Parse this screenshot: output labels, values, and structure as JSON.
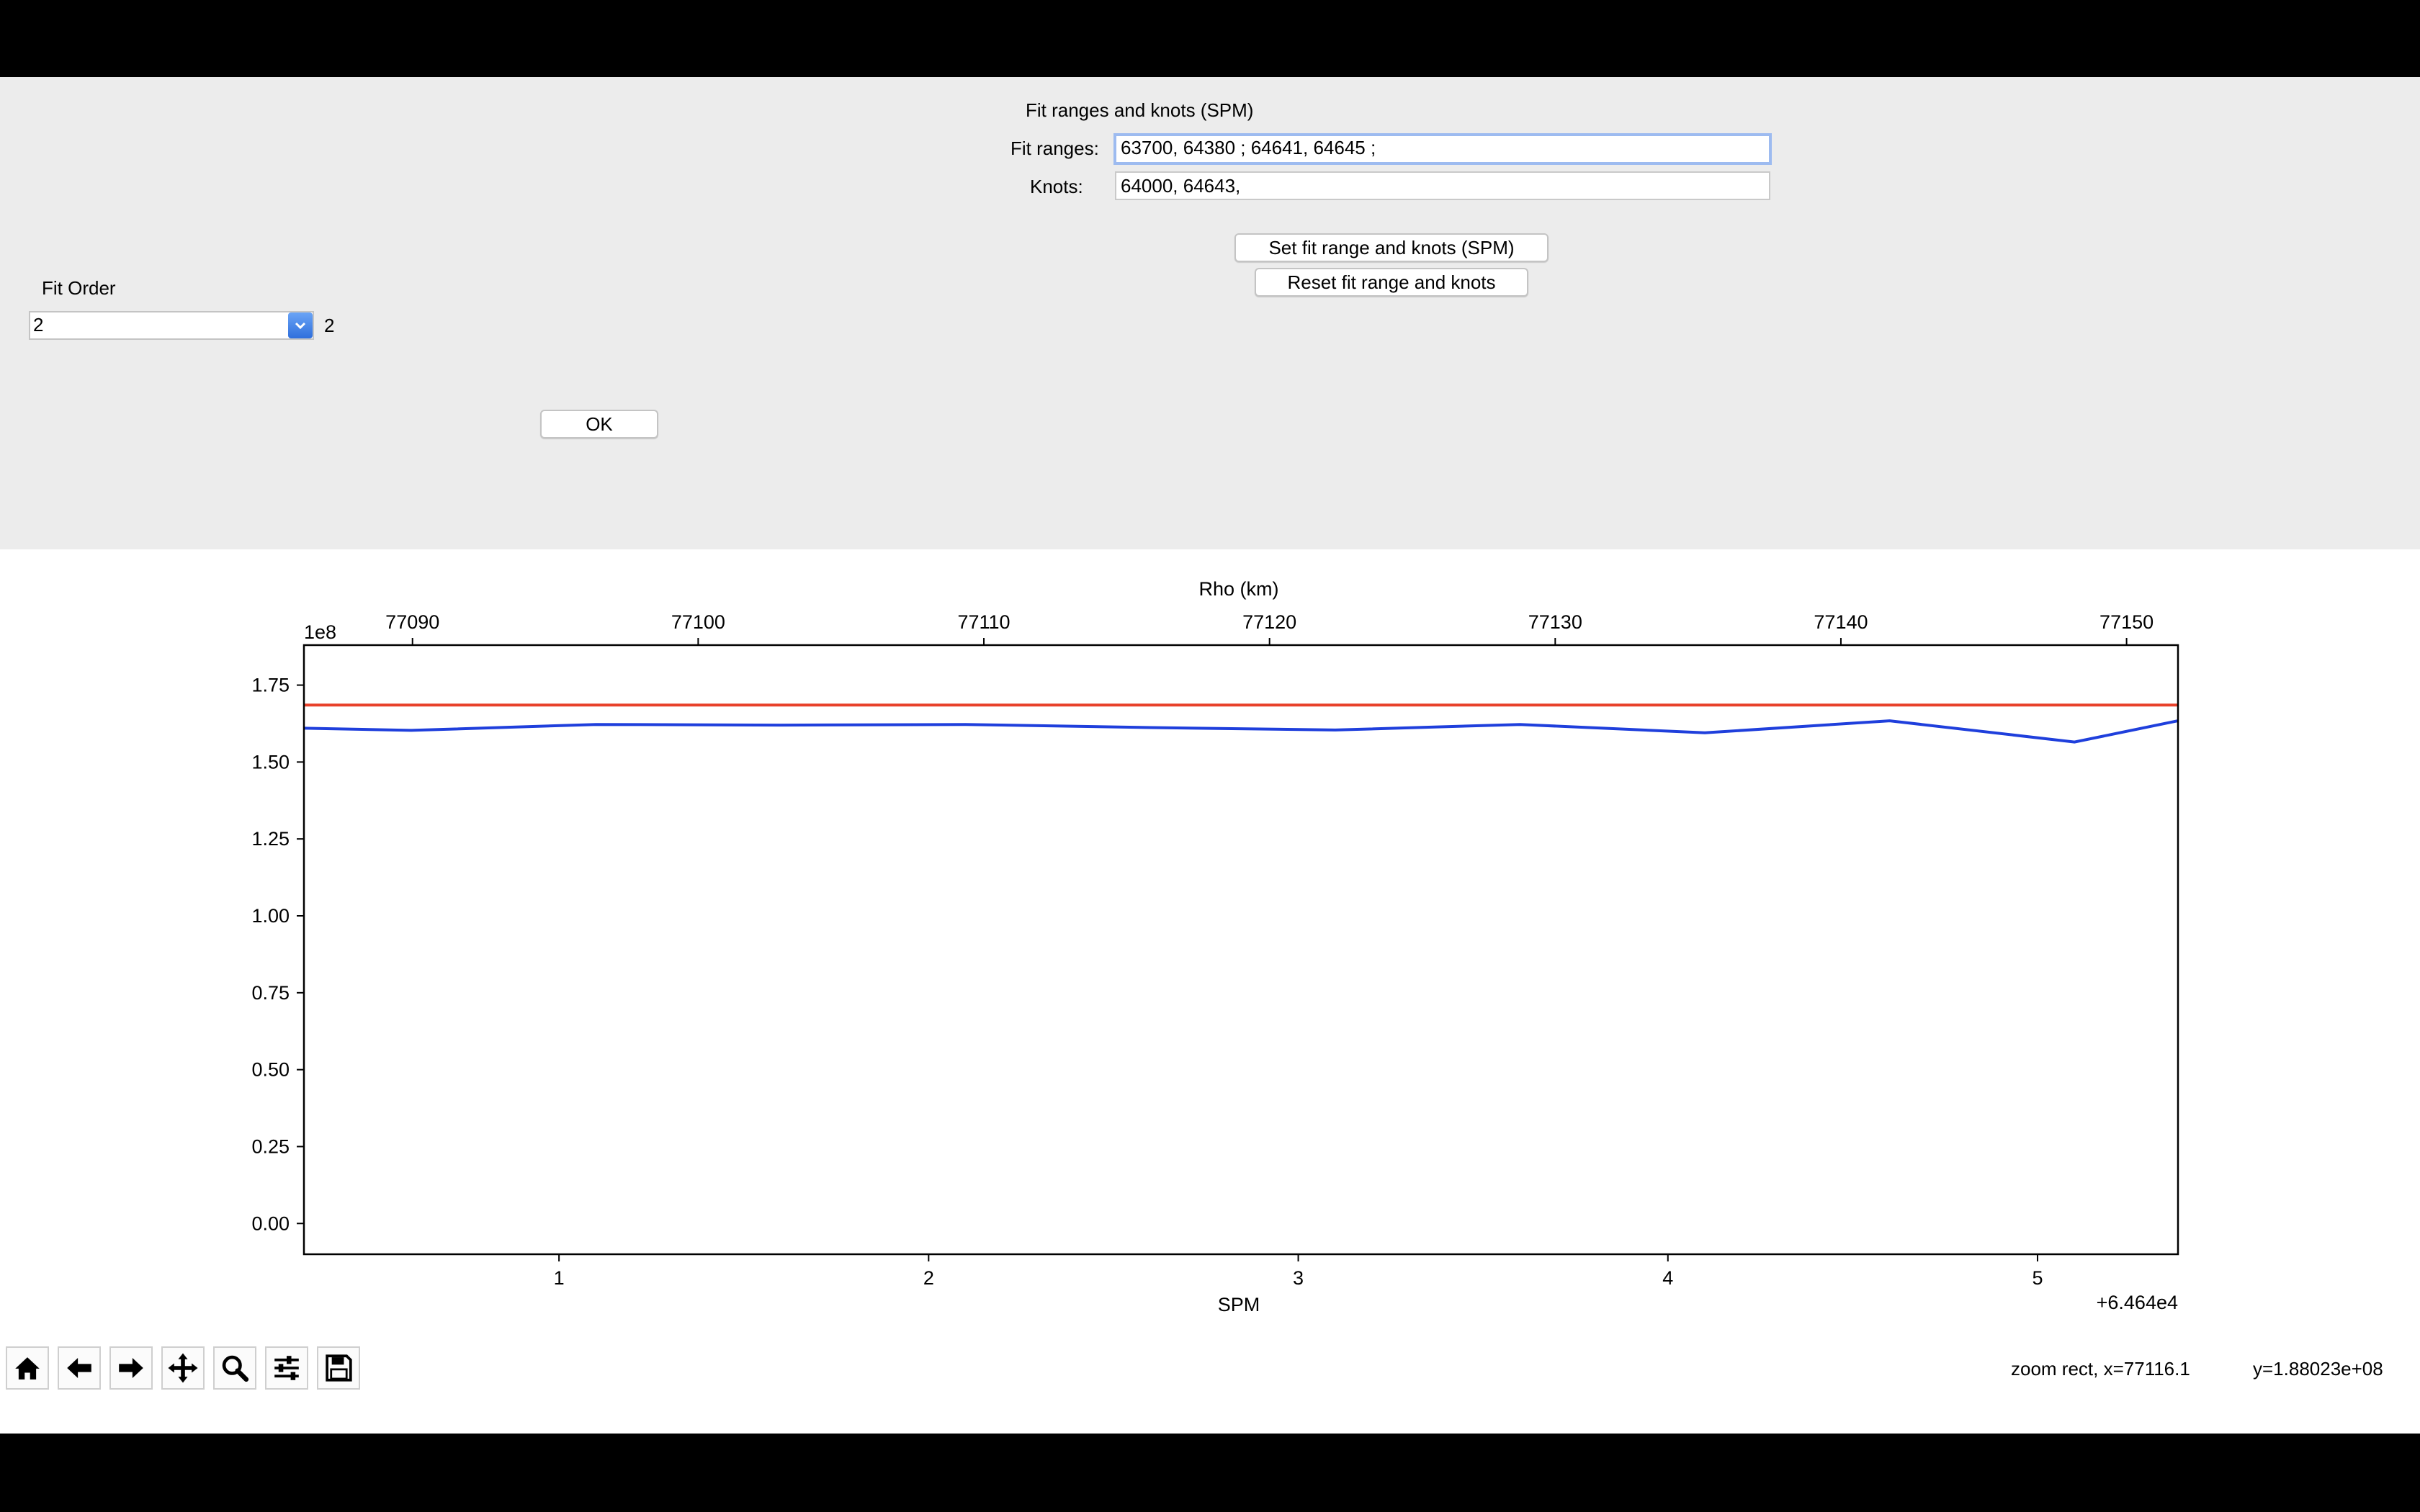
{
  "fit_panel": {
    "title": "Fit ranges and knots (SPM)",
    "fit_ranges_label": "Fit ranges:",
    "fit_ranges_value": "63700, 64380 ; 64641, 64645 ;",
    "knots_label": "Knots:",
    "knots_value": "64000, 64643,",
    "set_button": "Set fit range and knots (SPM)",
    "reset_button": "Reset fit range and knots"
  },
  "fit_order": {
    "label": "Fit Order",
    "selected": "2",
    "value_display": "2"
  },
  "ok_button": "OK",
  "toolbar": {
    "icons": [
      "home-icon",
      "back-arrow-icon",
      "forward-arrow-icon",
      "pan-icon",
      "zoom-icon",
      "configure-subplots-icon",
      "save-icon"
    ],
    "status_x": "zoom rect, x=77116.1",
    "status_y": "y=1.88023e+08"
  },
  "chart_data": {
    "type": "line",
    "xlabel": "SPM",
    "x_offset_label": "+6.464e4",
    "x_ticks": [
      "1",
      "2",
      "3",
      "4",
      "5"
    ],
    "xlim": [
      0.31,
      5.38
    ],
    "top_xlabel": "Rho (km)",
    "top_x_ticks": [
      "77090",
      "77100",
      "77110",
      "77120",
      "77130",
      "77140",
      "77150"
    ],
    "top_xlim": [
      77086.2,
      77151.8
    ],
    "y_scale_label": "1e8",
    "y_ticks": [
      "0.00",
      "0.25",
      "0.50",
      "0.75",
      "1.00",
      "1.25",
      "1.50",
      "1.75"
    ],
    "ylim": [
      -0.1,
      1.88
    ],
    "series": [
      {
        "color": "#1f3fdc",
        "x": [
          0.31,
          0.6,
          1.1,
          1.6,
          2.1,
          2.6,
          3.1,
          3.6,
          4.1,
          4.6,
          5.1,
          5.38
        ],
        "y": [
          1.61,
          1.603,
          1.622,
          1.62,
          1.622,
          1.612,
          1.604,
          1.622,
          1.595,
          1.634,
          1.565,
          1.634
        ]
      },
      {
        "color": "#e8412a",
        "x": [
          0.31,
          5.38
        ],
        "y": [
          1.685,
          1.685
        ]
      }
    ]
  }
}
